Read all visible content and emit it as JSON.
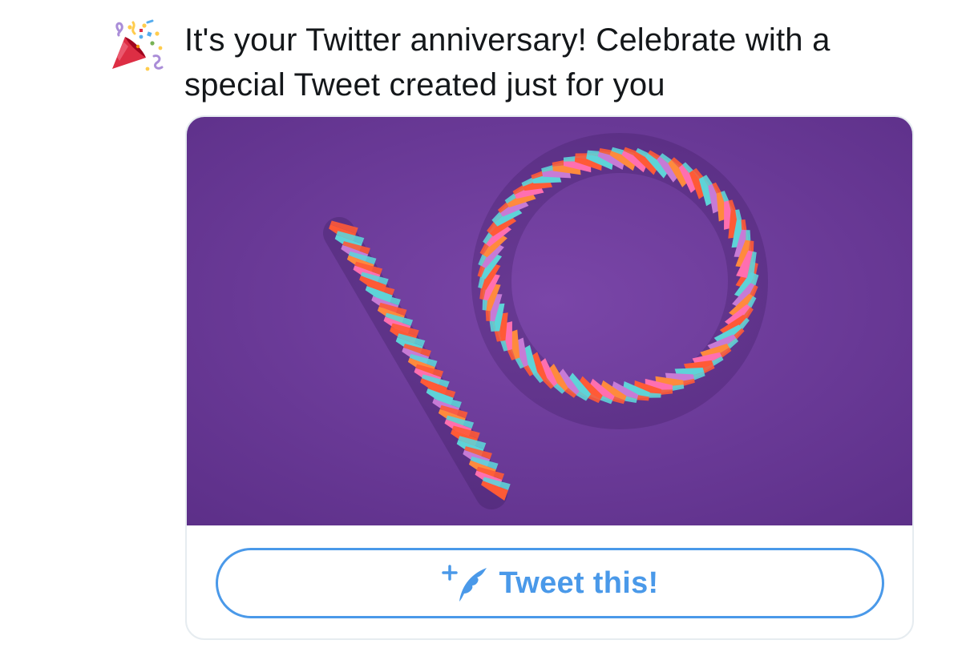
{
  "prompt": {
    "icon": "party-popper-icon",
    "message": "It's your Twitter anniversary! Celebrate with a special Tweet created just for you"
  },
  "card": {
    "image": "folded-paper-number-10",
    "button": {
      "icon": "compose-quill-icon",
      "label": "Tweet this!"
    }
  },
  "colors": {
    "text": "#14171a",
    "accent": "#4a99e9",
    "image_background": "#6c3a9a",
    "card_border": "#e6ecf0"
  }
}
